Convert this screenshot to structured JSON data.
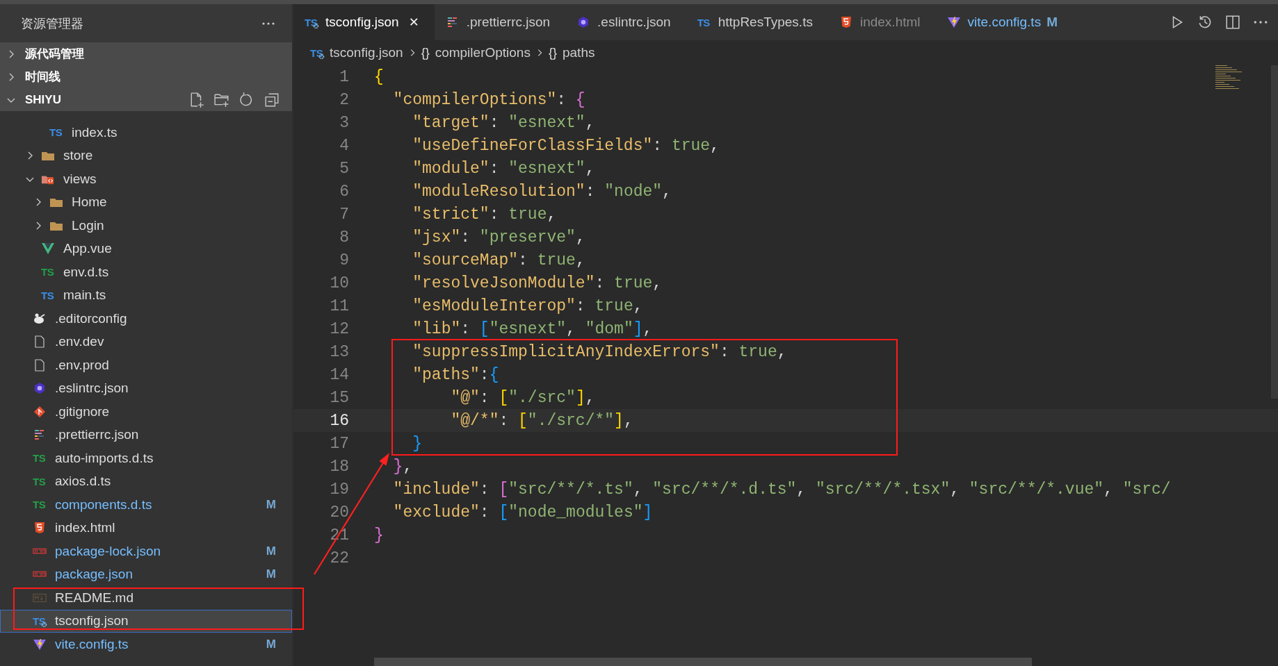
{
  "sidebar": {
    "title": "资源管理器",
    "sections": [
      {
        "label": "源代码管理",
        "expanded": false
      },
      {
        "label": "时间线",
        "expanded": false
      },
      {
        "label": "SHIYU",
        "expanded": true
      }
    ],
    "tree": [
      {
        "kind": "group",
        "children": [
          {
            "kind": "group",
            "children": [
              {
                "label": "index.ts",
                "kind": "ts",
                "icon_text": "TS",
                "selected": false,
                "modified": false
              }
            ]
          },
          {
            "label": "store",
            "kind": "folder",
            "expanded": false,
            "selected": false,
            "modified": false
          },
          {
            "label": "views",
            "kind": "views",
            "expanded": true,
            "selected": false,
            "modified": false,
            "children": [
              {
                "label": "Home",
                "kind": "folder",
                "expanded": false,
                "selected": false,
                "modified": false
              },
              {
                "label": "Login",
                "kind": "folder",
                "expanded": false,
                "selected": false,
                "modified": false
              }
            ]
          },
          {
            "label": "App.vue",
            "kind": "vue",
            "selected": false,
            "modified": false
          },
          {
            "label": "env.d.ts",
            "kind": "dts",
            "icon_text": "TS",
            "selected": false,
            "modified": false
          },
          {
            "label": "main.ts",
            "kind": "ts",
            "icon_text": "TS",
            "selected": false,
            "modified": false
          }
        ]
      },
      {
        "label": ".editorconfig",
        "kind": "editorconfig",
        "selected": false,
        "modified": false
      },
      {
        "label": ".env.dev",
        "kind": "file",
        "selected": false,
        "modified": false
      },
      {
        "label": ".env.prod",
        "kind": "file",
        "selected": false,
        "modified": false
      },
      {
        "label": ".eslintrc.json",
        "kind": "eslint",
        "selected": false,
        "modified": false
      },
      {
        "label": ".gitignore",
        "kind": "git",
        "selected": false,
        "modified": false
      },
      {
        "label": ".prettierrc.json",
        "kind": "prettier",
        "selected": false,
        "modified": false
      },
      {
        "label": "auto-imports.d.ts",
        "kind": "dts",
        "icon_text": "TS",
        "selected": false,
        "modified": false
      },
      {
        "label": "axios.d.ts",
        "kind": "dts",
        "icon_text": "TS",
        "selected": false,
        "modified": false
      },
      {
        "label": "components.d.ts",
        "kind": "dts",
        "icon_text": "TS",
        "selected": false,
        "modified": true,
        "badge": "M"
      },
      {
        "label": "index.html",
        "kind": "html",
        "selected": false,
        "modified": false
      },
      {
        "label": "package-lock.json",
        "kind": "npm",
        "selected": false,
        "modified": true,
        "badge": "M"
      },
      {
        "label": "package.json",
        "kind": "npm",
        "selected": false,
        "modified": true,
        "badge": "M"
      },
      {
        "label": "README.md",
        "kind": "md",
        "selected": false,
        "modified": false
      },
      {
        "label": "tsconfig.json",
        "kind": "tsconfig",
        "icon_text": "TS",
        "selected": true,
        "modified": false
      },
      {
        "label": "vite.config.ts",
        "kind": "vite",
        "selected": false,
        "modified": true,
        "badge": "M"
      }
    ]
  },
  "tabs": [
    {
      "label": "tsconfig.json",
      "kind": "tsconfig",
      "icon_text": "TS",
      "selected": true,
      "dimmed": false,
      "modified": false,
      "close": "✕"
    },
    {
      "label": ".prettierrc.json",
      "kind": "prettier",
      "selected": false,
      "dimmed": false,
      "modified": false
    },
    {
      "label": ".eslintrc.json",
      "kind": "eslint",
      "selected": false,
      "dimmed": false,
      "modified": false
    },
    {
      "label": "httpResTypes.ts",
      "kind": "ts",
      "icon_text": "TS",
      "selected": false,
      "dimmed": false,
      "modified": false
    },
    {
      "label": "index.html",
      "kind": "html",
      "selected": false,
      "dimmed": true,
      "modified": false
    },
    {
      "label": "vite.config.ts",
      "kind": "vite",
      "selected": false,
      "dimmed": false,
      "modified": true,
      "badge": "M"
    }
  ],
  "breadcrumb": [
    {
      "label": "tsconfig.json",
      "kind": "tsconfig",
      "icon_text": "TS"
    },
    {
      "label": "compilerOptions",
      "kind": "braces",
      "icon_text": "{}"
    },
    {
      "label": "paths",
      "kind": "braces",
      "icon_text": "{}"
    }
  ],
  "code_lines": [
    {
      "number": "1",
      "current": false,
      "text": "{"
    },
    {
      "number": "2",
      "current": false,
      "text": "  \"compilerOptions\": {"
    },
    {
      "number": "3",
      "current": false,
      "text": "    \"target\": \"esnext\","
    },
    {
      "number": "4",
      "current": false,
      "text": "    \"useDefineForClassFields\": true,"
    },
    {
      "number": "5",
      "current": false,
      "text": "    \"module\": \"esnext\","
    },
    {
      "number": "6",
      "current": false,
      "text": "    \"moduleResolution\": \"node\","
    },
    {
      "number": "7",
      "current": false,
      "text": "    \"strict\": true,"
    },
    {
      "number": "8",
      "current": false,
      "text": "    \"jsx\": \"preserve\","
    },
    {
      "number": "9",
      "current": false,
      "text": "    \"sourceMap\": true,"
    },
    {
      "number": "10",
      "current": false,
      "text": "    \"resolveJsonModule\": true,"
    },
    {
      "number": "11",
      "current": false,
      "text": "    \"esModuleInterop\": true,"
    },
    {
      "number": "12",
      "current": false,
      "text": "    \"lib\": [\"esnext\", \"dom\"],"
    },
    {
      "number": "13",
      "current": false,
      "text": "    \"suppressImplicitAnyIndexErrors\": true,"
    },
    {
      "number": "14",
      "current": false,
      "text": "    \"paths\":{"
    },
    {
      "number": "15",
      "current": false,
      "text": "        \"@\": [\"./src\"],"
    },
    {
      "number": "16",
      "current": true,
      "text": "        \"@/*\": [\"./src/*\"],"
    },
    {
      "number": "17",
      "current": false,
      "text": "    }"
    },
    {
      "number": "18",
      "current": false,
      "text": "  },"
    },
    {
      "number": "19",
      "current": false,
      "text": "  \"include\": [\"src/**/*.ts\", \"src/**/*.d.ts\", \"src/**/*.tsx\", \"src/**/*.vue\", \"src/"
    },
    {
      "number": "20",
      "current": false,
      "text": "  \"exclude\": [\"node_modules\"]"
    },
    {
      "number": "21",
      "current": false,
      "text": "}"
    },
    {
      "number": "22",
      "current": false
    }
  ]
}
